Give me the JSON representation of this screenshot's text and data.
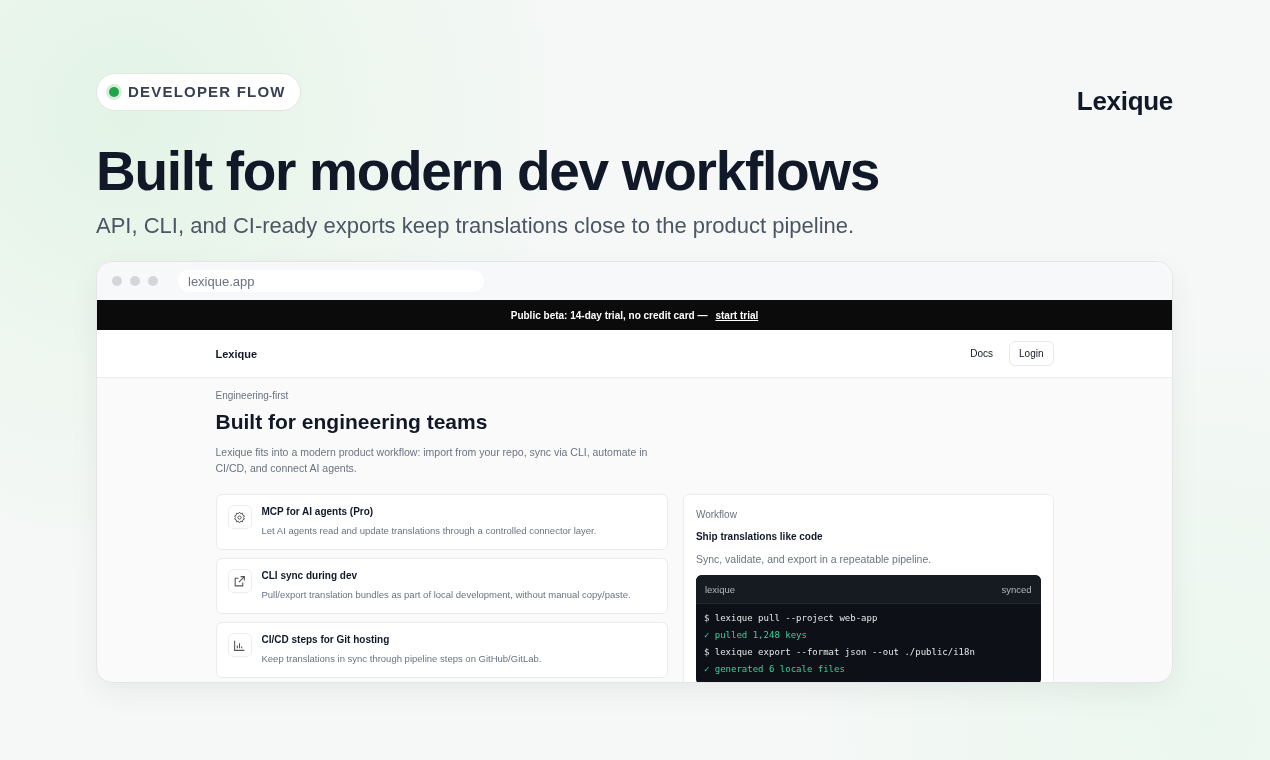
{
  "badge": {
    "label": "DEVELOPER FLOW",
    "color": "#22a34a"
  },
  "brand": "Lexique",
  "headline": "Built for modern dev workflows",
  "subtitle": "API, CLI, and CI-ready exports keep translations close to the product pipeline.",
  "browser": {
    "url": "lexique.app",
    "banner": {
      "text": "Public beta: 14-day trial, no credit card —",
      "link": "start trial"
    },
    "nav": {
      "logo": "Lexique",
      "links": [
        "Docs"
      ],
      "button": "Login"
    },
    "eyebrow": "Engineering-first",
    "title": "Built for engineering teams",
    "intro": "Lexique fits into a modern product workflow: import from your repo, sync via CLI, automate in CI/CD, and connect AI agents.",
    "features": [
      {
        "kind": "gear",
        "title": "MCP for AI agents (Pro)",
        "text": "Let AI agents read and update translations through a controlled connector layer."
      },
      {
        "kind": "external",
        "title": "CLI sync during dev",
        "text": "Pull/export translation bundles as part of local development, without manual copy/paste."
      },
      {
        "kind": "chart",
        "title": "CI/CD steps for Git hosting",
        "text": "Keep translations in sync through pipeline steps on GitHub/GitLab."
      }
    ],
    "workflow": {
      "eyebrow": "Workflow",
      "title": "Ship translations like code",
      "text": "Sync, validate, and export in a repeatable pipeline.",
      "terminal": {
        "name": "lexique",
        "status": "synced",
        "lines": [
          {
            "kind": "command",
            "text": "$ lexique pull --project web-app"
          },
          {
            "kind": "output",
            "text": "✓ pulled 1,248 keys"
          },
          {
            "kind": "command",
            "text": "$ lexique export --format json --out ./public/i18n"
          },
          {
            "kind": "output",
            "text": "✓ generated 6 locale files"
          }
        ]
      }
    }
  }
}
